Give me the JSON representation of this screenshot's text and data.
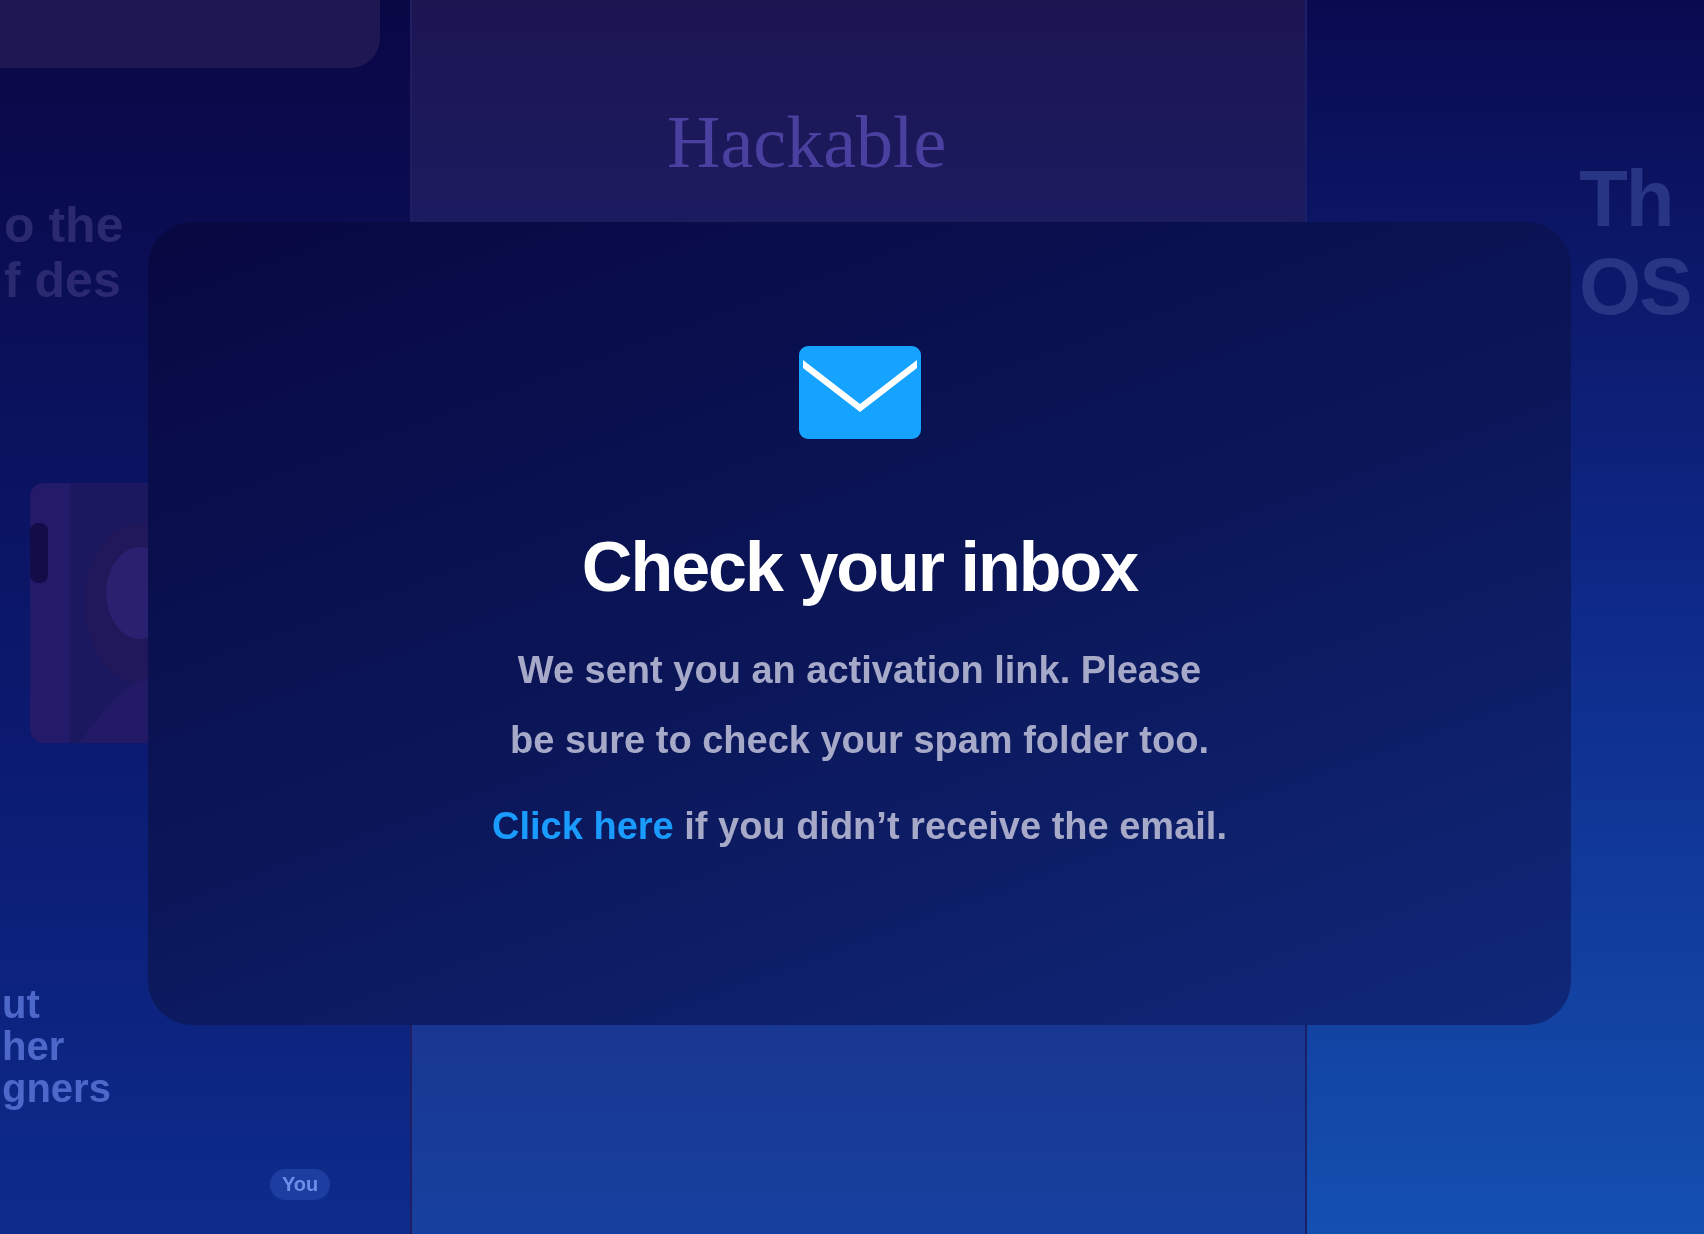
{
  "background": {
    "left_tile": {
      "headline": [
        "o the",
        "f des"
      ],
      "photo": {
        "kind": "picture"
      },
      "subhead": [
        "ut",
        "her",
        "gners"
      ],
      "badge": "You"
    },
    "middle_tile": {
      "headline": "Hackable"
    },
    "right_tile": {
      "headline": [
        "Th",
        "OS"
      ]
    }
  },
  "dialog": {
    "title": "Check your inbox",
    "message": "We sent you an activation link. Please be sure to check your spam folder too.",
    "link": "Click here",
    "after_link": " if you didn’t receive the email."
  }
}
